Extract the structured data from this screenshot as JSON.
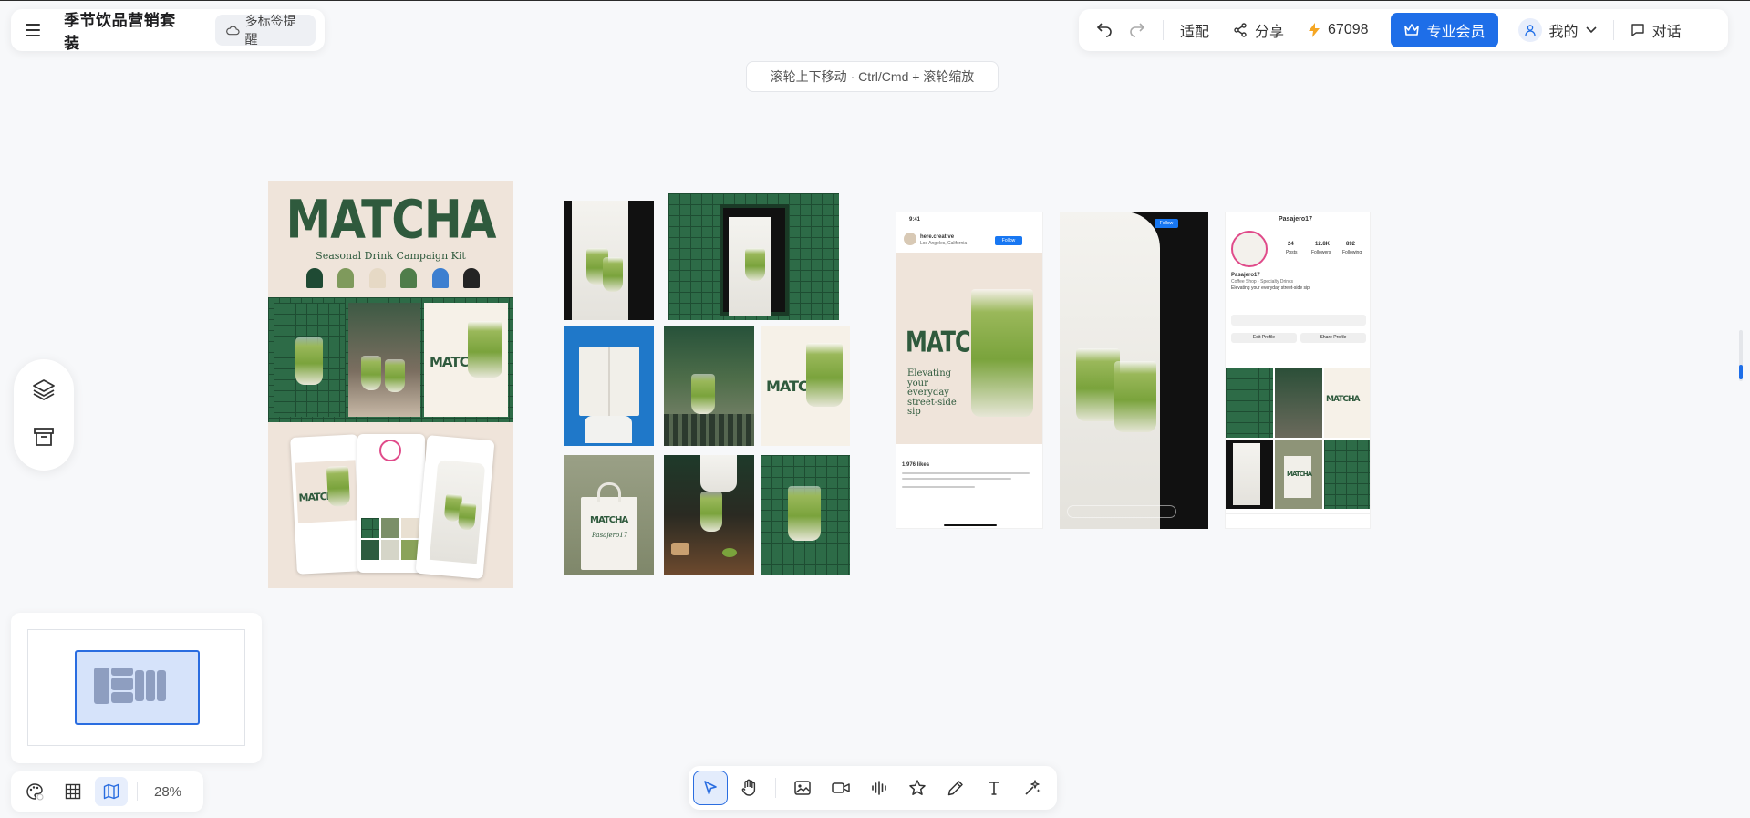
{
  "header": {
    "doc_title": "季节饮品营销套装",
    "tag_button": "多标签提醒",
    "fit": "适配",
    "share": "分享",
    "credits": "67098",
    "pro": "专业会员",
    "mine": "我的",
    "chat": "对话"
  },
  "hint": "滚轮上下移动 · Ctrl/Cmd + 滚轮缩放",
  "zoom": "28%",
  "colors": {
    "accent": "#1e6ee8",
    "matcha_green": "#2f5a3d",
    "tile_green": "#2d6b47",
    "credit_bolt": "#f5a623"
  },
  "icons": {
    "menu": "menu-icon",
    "cloud": "cloud-icon",
    "undo": "undo-icon",
    "redo": "redo-icon",
    "share": "share-icon",
    "bolt": "bolt-icon",
    "crown": "crown-icon",
    "user": "user-icon",
    "chevron": "chevron-down-icon",
    "chat": "chat-icon",
    "layers": "layers-icon",
    "archive": "archive-icon",
    "palette": "palette-icon",
    "grid": "grid-icon",
    "map": "map-icon",
    "select": "cursor-icon",
    "hand": "hand-icon",
    "image": "image-icon",
    "video": "video-icon",
    "audio": "audio-icon",
    "star": "star-icon",
    "pen": "pen-icon",
    "text": "text-icon",
    "magic": "magic-icon"
  },
  "canvas": {
    "poster": {
      "title": "MATCHA",
      "subtitle": "Seasonal Drink Campaign Kit",
      "swatch_colors": [
        "#1f4a34",
        "#7f9a5c",
        "#e6d9c5",
        "#4f7d4a",
        "#3d7fd0",
        "#242424"
      ],
      "inner_word": "MATCHA"
    },
    "grid_tiles": {
      "bag_word": "MATCHA",
      "bag_brand": "Pasajero17",
      "card_word": "MATCHA"
    },
    "ig_post": {
      "time": "9:41",
      "account": "here.creative",
      "location": "Los Angeles, California",
      "follow": "Follow",
      "word": "MATCHA",
      "tagline": "Elevating your everyday street-side sip",
      "likes": "1,976 likes"
    },
    "ig_story": {
      "follow": "Follow"
    },
    "ig_profile": {
      "handle": "Pasajero17",
      "posts_count": "24",
      "posts_label": "Posts",
      "followers_count": "12.8K",
      "followers_label": "Followers",
      "following_count": "892",
      "following_label": "Following",
      "name": "Pasajero17",
      "bio_1": "Coffee Shop · Specialty Drinks",
      "bio_2": "Elevating your everyday street-side sip",
      "edit": "Edit Profile",
      "share": "Share Profile",
      "grid_word": "MATCHA",
      "grid_word_2": "MATCHA"
    }
  }
}
